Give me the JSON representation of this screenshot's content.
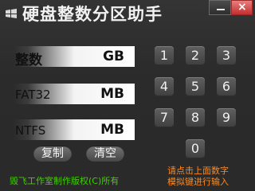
{
  "window": {
    "title": "硬盘整数分区助手",
    "minimize_label": "−",
    "close_label": "×"
  },
  "fields": [
    {
      "label": "整数",
      "unit": "GB"
    },
    {
      "label": "FAT32",
      "unit": "MB"
    },
    {
      "label": "NTFS",
      "unit": "MB"
    }
  ],
  "buttons": {
    "copy": "复制",
    "clear": "清空"
  },
  "keypad": [
    "1",
    "2",
    "3",
    "4",
    "5",
    "6",
    "7",
    "8",
    "9",
    "0"
  ],
  "footer": {
    "copyright": "毁飞工作室制作版权(C)所有"
  },
  "hint": {
    "line1": "请点击上面数字",
    "line2": "模拟键进行输入"
  },
  "colors": {
    "footer_green": "#40d000",
    "hint_orange": "#ff8a1e",
    "close_red": "#c72d2d"
  }
}
